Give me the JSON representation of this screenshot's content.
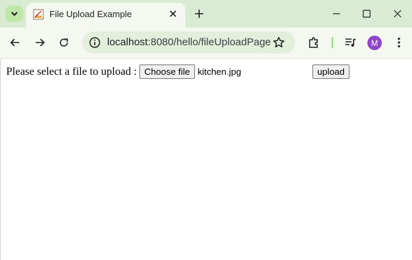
{
  "browser": {
    "tab": {
      "title": "File Upload Example",
      "favicon": "image-icon"
    },
    "omnibox": {
      "host": "localhost",
      "path": ":8080/hello/fileUploadPage"
    },
    "profile": {
      "initial": "M",
      "color": "#8e45c9"
    },
    "colors": {
      "frame": "#d9ebd3",
      "toolbar": "#f4f8f0",
      "omnibox": "#e3eedb"
    }
  },
  "page": {
    "prompt": "Please select a file to upload :",
    "choose_label": "Choose file",
    "selected_file": "kitchen.jpg",
    "upload_label": "upload"
  }
}
